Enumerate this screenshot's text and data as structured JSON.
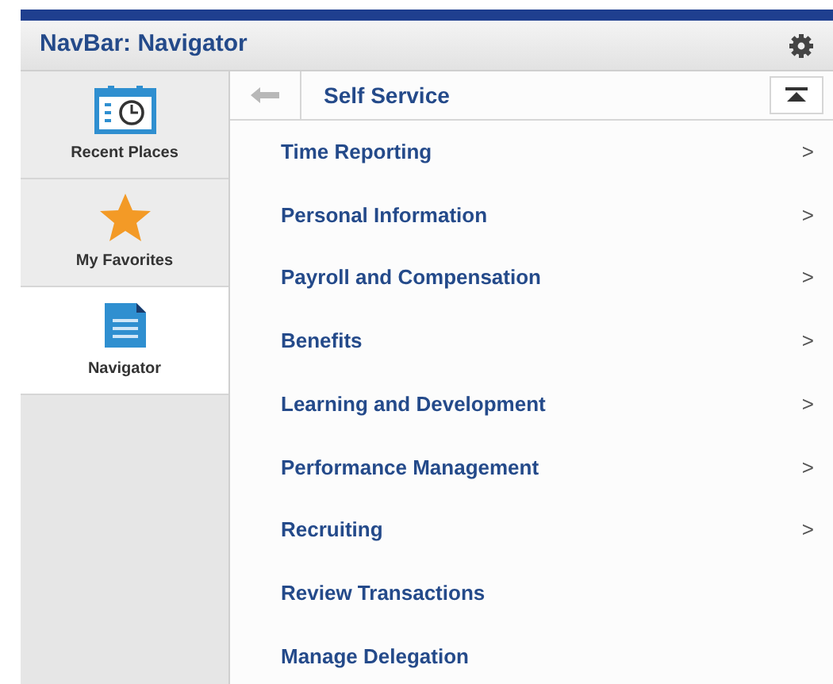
{
  "navbar": {
    "title": "NavBar: Navigator"
  },
  "sidebar": {
    "items": [
      {
        "label": "Recent Places",
        "kind": "calendar",
        "selected": false
      },
      {
        "label": "My Favorites",
        "kind": "star",
        "selected": false
      },
      {
        "label": "Navigator",
        "kind": "document",
        "selected": true
      }
    ]
  },
  "panel": {
    "title": "Self Service",
    "items": [
      {
        "label": "Time Reporting",
        "chevron": ">"
      },
      {
        "label": "Personal Information",
        "chevron": ">"
      },
      {
        "label": "Payroll and Compensation",
        "chevron": ">"
      },
      {
        "label": "Benefits",
        "chevron": ">"
      },
      {
        "label": "Learning and Development",
        "chevron": ">"
      },
      {
        "label": "Performance Management",
        "chevron": ">"
      },
      {
        "label": "Recruiting",
        "chevron": ">"
      },
      {
        "label": "Review Transactions"
      },
      {
        "label": "Manage Delegation"
      }
    ]
  }
}
